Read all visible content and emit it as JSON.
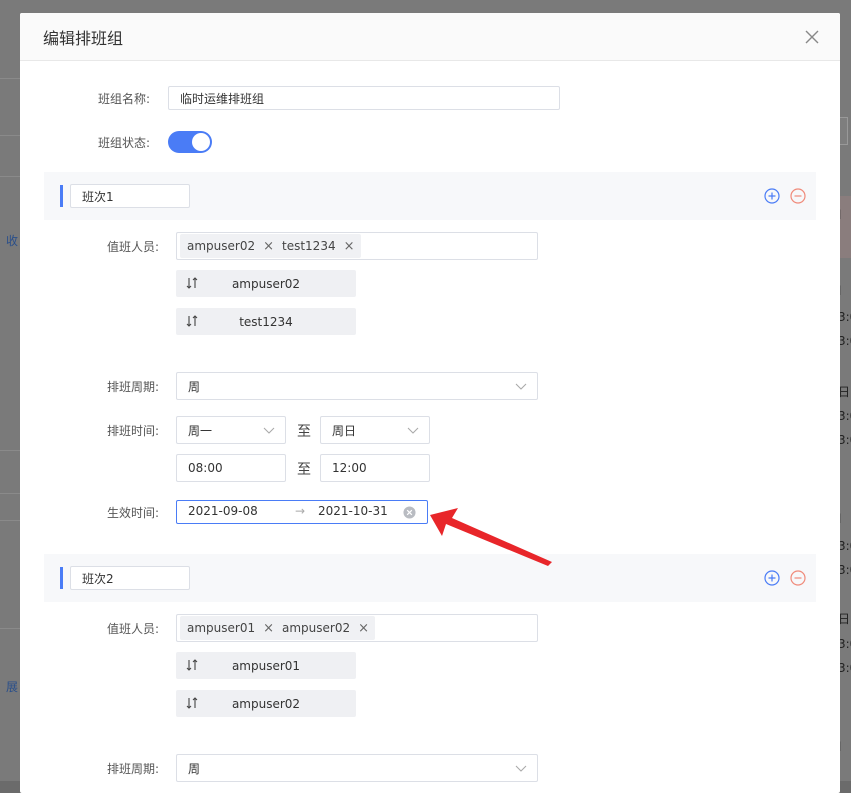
{
  "background": {
    "left_texts": [
      "收",
      "展"
    ],
    "right_texts": [
      "l",
      "3:0",
      "3:0",
      "日",
      "3:0",
      "3:0",
      "l",
      "3:0",
      "3:0",
      "日",
      "3:0",
      "3:0",
      "l"
    ]
  },
  "modal": {
    "title": "编辑排班组",
    "group_name_label": "班组名称:",
    "group_name_value": "临时运维排班组",
    "group_status_label": "班组状态:",
    "group_status_on": true
  },
  "shifts": [
    {
      "name": "班次1",
      "staff_label": "值班人员:",
      "tags": [
        "ampuser02",
        "test1234"
      ],
      "order": [
        "ampuser02",
        "test1234"
      ],
      "cycle_label": "排班周期:",
      "cycle_value": "周",
      "time_label": "排班时间:",
      "day_from": "周一",
      "day_to": "周日",
      "to_text": "至",
      "time_from": "08:00",
      "time_to": "12:00",
      "effective_label": "生效时间:",
      "effective_from": "2021-09-08",
      "effective_to": "2021-10-31",
      "range_arrow": "→"
    },
    {
      "name": "班次2",
      "staff_label": "值班人员:",
      "tags": [
        "ampuser01",
        "ampuser02"
      ],
      "order": [
        "ampuser01",
        "ampuser02"
      ],
      "cycle_label": "排班周期:",
      "cycle_value": "周"
    }
  ],
  "colors": {
    "accent": "#4a7cf6",
    "danger": "#f08a7a",
    "annotation_arrow": "#e8262a"
  },
  "icons": {
    "close": "close-icon",
    "add": "plus-circle-icon",
    "remove": "minus-circle-icon",
    "sort": "sort-icon",
    "caret": "chevron-down-icon",
    "clear": "clear-circle-icon"
  }
}
